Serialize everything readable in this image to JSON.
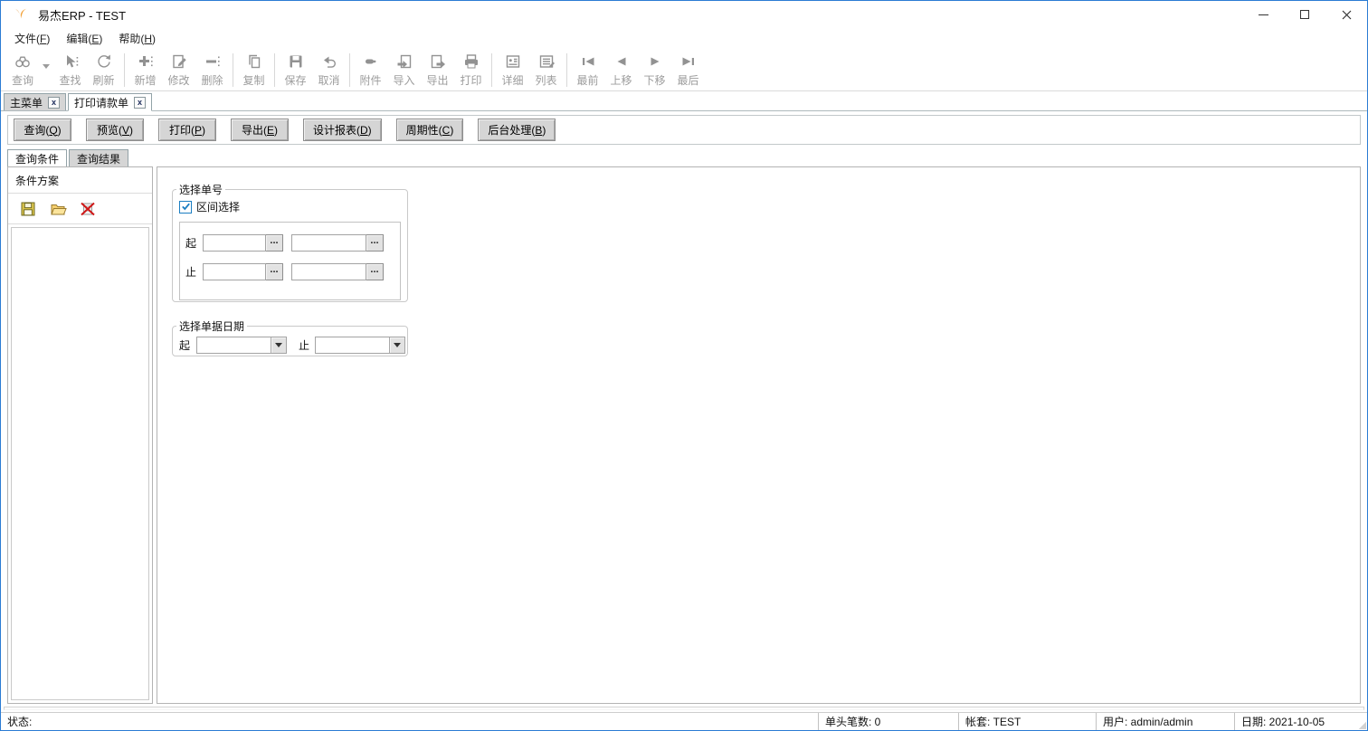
{
  "window": {
    "title": "易杰ERP - TEST",
    "controls": {
      "minimize": "minimize-icon",
      "maximize": "maximize-icon",
      "close": "close-icon",
      "close_glyph": "✕"
    }
  },
  "menubar": {
    "items": [
      {
        "pre": "文件(",
        "key": "F",
        "post": ")"
      },
      {
        "pre": "编辑(",
        "key": "E",
        "post": ")"
      },
      {
        "pre": "帮助(",
        "key": "H",
        "post": ")"
      }
    ]
  },
  "toolbar": {
    "items": [
      {
        "label": "查询",
        "icon": "binoculars-icon"
      },
      {
        "label": "查找",
        "icon": "pointer-icon"
      },
      {
        "label": "刷新",
        "icon": "refresh-icon"
      },
      {
        "label": "新增",
        "icon": "add-icon"
      },
      {
        "label": "修改",
        "icon": "edit-icon"
      },
      {
        "label": "删除",
        "icon": "delete-icon"
      },
      {
        "label": "复制",
        "icon": "copy-icon"
      },
      {
        "label": "保存",
        "icon": "save-icon"
      },
      {
        "label": "取消",
        "icon": "undo-icon"
      },
      {
        "label": "附件",
        "icon": "attachment-icon"
      },
      {
        "label": "导入",
        "icon": "import-icon"
      },
      {
        "label": "导出",
        "icon": "export-icon"
      },
      {
        "label": "打印",
        "icon": "print-icon"
      },
      {
        "label": "详细",
        "icon": "detail-icon"
      },
      {
        "label": "列表",
        "icon": "list-icon"
      },
      {
        "label": "最前",
        "icon": "first-icon"
      },
      {
        "label": "上移",
        "icon": "move-up-icon"
      },
      {
        "label": "下移",
        "icon": "move-down-icon"
      },
      {
        "label": "最后",
        "icon": "last-icon"
      }
    ]
  },
  "doc_tabs": {
    "tabs": [
      {
        "label": "主菜单",
        "close": "x",
        "active": false
      },
      {
        "label": "打印请款单",
        "close": "x",
        "active": true
      }
    ]
  },
  "action_buttons": [
    {
      "pre": "查询(",
      "key": "Q",
      "post": ")"
    },
    {
      "pre": "预览(",
      "key": "V",
      "post": ")"
    },
    {
      "pre": "打印(",
      "key": "P",
      "post": ")"
    },
    {
      "pre": "导出(",
      "key": "E",
      "post": ")"
    },
    {
      "pre": "设计报表(",
      "key": "D",
      "post": ")"
    },
    {
      "pre": "周期性(",
      "key": "C",
      "post": ")"
    },
    {
      "pre": "后台处理(",
      "key": "B",
      "post": ")"
    }
  ],
  "condition_tabs": [
    {
      "label": "查询条件",
      "active": true
    },
    {
      "label": "查询结果",
      "active": false
    }
  ],
  "left_panel": {
    "title": "条件方案",
    "icons": [
      {
        "name": "save-scheme",
        "icon": "floppy-icon"
      },
      {
        "name": "open-scheme",
        "icon": "folder-icon"
      },
      {
        "name": "delete-scheme",
        "icon": "delete-x-icon"
      }
    ]
  },
  "form": {
    "order_group": {
      "legend": "选择单号",
      "checkbox_label": "区间选择",
      "checkbox_checked": true,
      "from_label": "起",
      "to_label": "止",
      "ellipsis": "...",
      "inputs": {
        "from1": "",
        "from2": "",
        "to1": "",
        "to2": ""
      }
    },
    "date_group": {
      "legend": "选择单据日期",
      "from_label": "起",
      "to_label": "止",
      "from_value": "",
      "to_value": ""
    }
  },
  "statusbar": {
    "status_label": "状态:",
    "cells": [
      "单头笔数: 0",
      "帐套: TEST",
      "用户: admin/admin",
      "日期: 2021-10-05"
    ]
  },
  "colors": {
    "accent_blue": "#1b7ec2",
    "window_border": "#2b7cd3",
    "disabled_gray": "#9c9c9c",
    "button_face": "#d5d5d5",
    "logo_orange": "#ed8b1f"
  }
}
